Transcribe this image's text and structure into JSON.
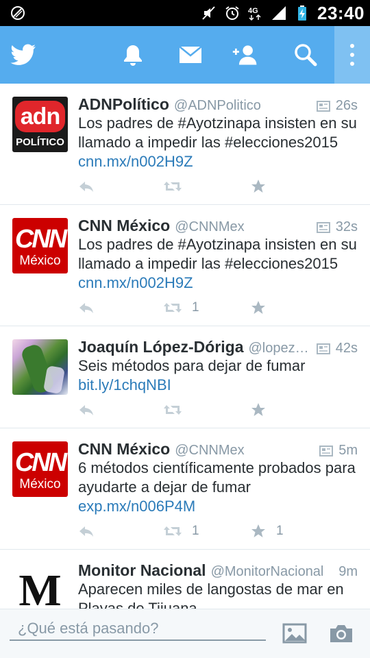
{
  "status_bar": {
    "time": "23:40",
    "network": "4G",
    "icons": [
      "sync-off-icon",
      "mute-icon",
      "alarm-icon",
      "network-4g-icon",
      "signal-icon",
      "battery-charging-icon"
    ]
  },
  "app_bar": {
    "logo": "twitter-bird-icon",
    "actions": [
      "notifications-bell-icon",
      "messages-envelope-icon",
      "add-user-icon",
      "search-icon",
      "overflow-menu-icon"
    ],
    "accent_color": "#55acee"
  },
  "tweets": [
    {
      "name": "ADNPolítico",
      "handle": "@ADNPolitico",
      "time": "26s",
      "text_plain": "Los padres de #Ayotzinapa insisten en su llamado a impedir las #elecciones2015 ",
      "link": "cnn.mx/n002H9Z",
      "avatar_line1": "adn",
      "avatar_line2": "POLÍTICO",
      "retweets": "",
      "favorites": ""
    },
    {
      "name": "CNN México",
      "handle": "@CNNMex",
      "time": "32s",
      "text_plain": "Los padres de #Ayotzinapa insisten en su llamado a impedir las #elecciones2015 ",
      "link": "cnn.mx/n002H9Z",
      "avatar_line1": "CNN",
      "avatar_line2": "México",
      "retweets": "1",
      "favorites": ""
    },
    {
      "name": "Joaquín López-Dóriga",
      "handle": "@lopez…",
      "time": "42s",
      "text_plain": "Seis métodos para dejar de fumar ",
      "link": "bit.ly/1chqNBI",
      "retweets": "",
      "favorites": ""
    },
    {
      "name": "CNN México",
      "handle": "@CNNMex",
      "time": "5m",
      "text_plain": "6 métodos científicamente probados para ayudarte a dejar de fumar ",
      "link": "exp.mx/n006P4M",
      "avatar_line1": "CNN",
      "avatar_line2": "México",
      "retweets": "1",
      "favorites": "1"
    },
    {
      "name": "Monitor Nacional",
      "handle": "@MonitorNacional",
      "time": "9m",
      "text_plain": "Aparecen miles de langostas de mar en Playas de Tijuana",
      "link": "",
      "avatar_line1": "M",
      "retweets": "",
      "favorites": ""
    }
  ],
  "compose": {
    "placeholder": "¿Qué está pasando?",
    "icons": [
      "image-icon",
      "camera-icon"
    ]
  },
  "colors": {
    "link": "#2b7bb9",
    "meta": "#8899a6",
    "cnn_red": "#cc0000"
  }
}
